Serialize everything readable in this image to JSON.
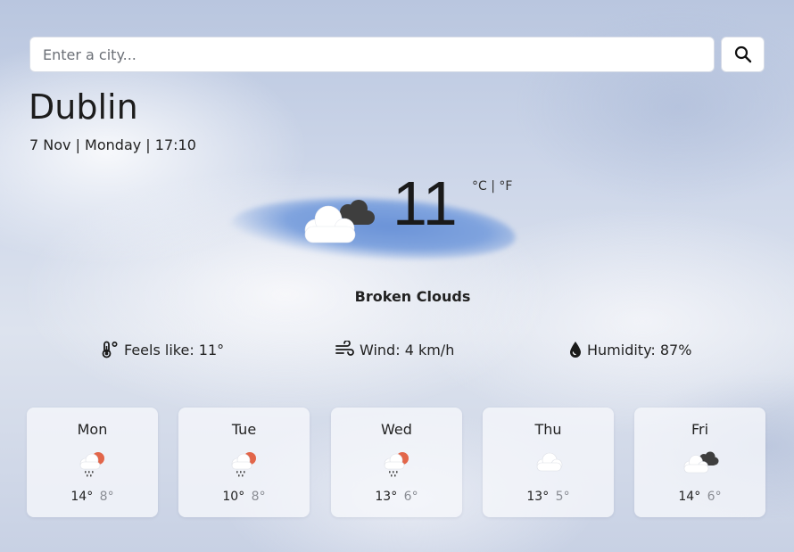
{
  "search": {
    "placeholder": "Enter a city...",
    "button_icon": "search-icon"
  },
  "location": {
    "city": "Dublin",
    "datetime": "7 Nov | Monday | 17:10"
  },
  "current": {
    "temperature": "11",
    "unit_celsius": "°C",
    "unit_separator": "|",
    "unit_fahrenheit": "°F",
    "icon": "broken-clouds-icon",
    "condition": "Broken Clouds"
  },
  "stats": {
    "feels_like": {
      "icon": "thermometer-icon",
      "text": "Feels like: 11°"
    },
    "wind": {
      "icon": "wind-icon",
      "text": "Wind: 4 km/h"
    },
    "humidity": {
      "icon": "droplet-icon",
      "text": "Humidity: 87%"
    }
  },
  "forecast": [
    {
      "day": "Mon",
      "icon": "rain-sun-icon",
      "high": "14°",
      "low": "8°"
    },
    {
      "day": "Tue",
      "icon": "rain-sun-icon",
      "high": "10°",
      "low": "8°"
    },
    {
      "day": "Wed",
      "icon": "rain-sun-icon",
      "high": "13°",
      "low": "6°"
    },
    {
      "day": "Thu",
      "icon": "cloud-icon",
      "high": "13°",
      "low": "5°"
    },
    {
      "day": "Fri",
      "icon": "broken-clouds-icon",
      "high": "14°",
      "low": "6°"
    }
  ],
  "colors": {
    "sun_orange": "#e2664a",
    "cloud_light": "#ffffff",
    "cloud_dark": "#3b3b3b",
    "rain": "#4a4a4a"
  }
}
